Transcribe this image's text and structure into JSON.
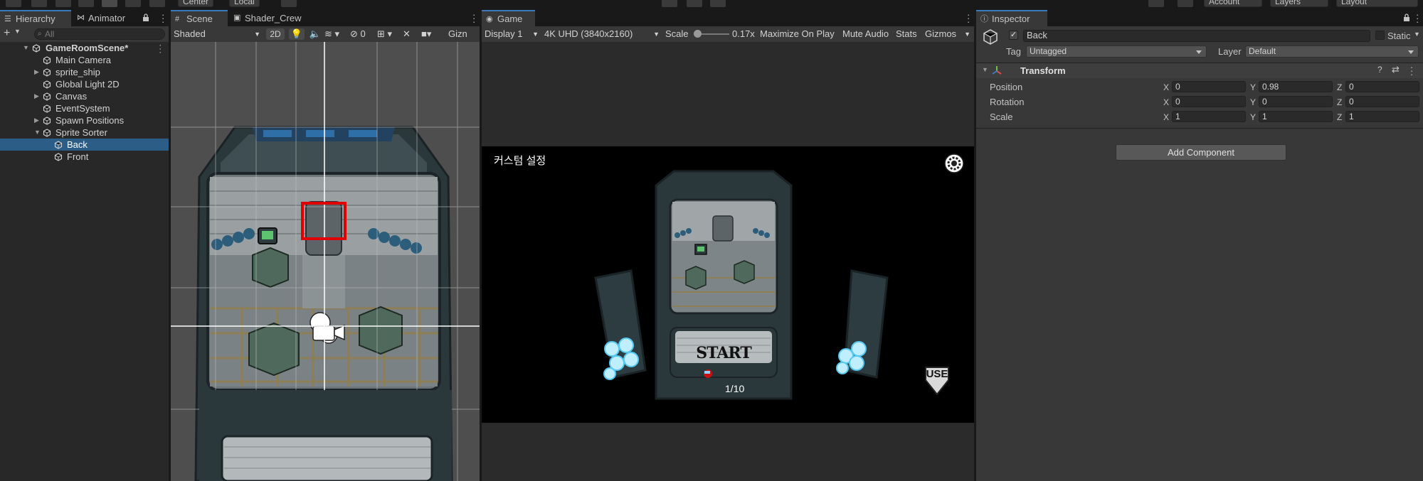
{
  "toolbar": {
    "pivot_center": "Center",
    "pivot_local": "Local",
    "account": "Account",
    "layers": "Layers",
    "layout": "Layout"
  },
  "hierarchy": {
    "tab_hierarchy": "Hierarchy",
    "tab_animator": "Animator",
    "search_placeholder": "All",
    "scene_name": "GameRoomScene*",
    "items": [
      {
        "label": "Main Camera",
        "depth": 1,
        "expand": ""
      },
      {
        "label": "sprite_ship",
        "depth": 1,
        "expand": "▶"
      },
      {
        "label": "Global Light 2D",
        "depth": 1,
        "expand": ""
      },
      {
        "label": "Canvas",
        "depth": 1,
        "expand": "▶"
      },
      {
        "label": "EventSystem",
        "depth": 1,
        "expand": ""
      },
      {
        "label": "Spawn Positions",
        "depth": 1,
        "expand": "▶"
      },
      {
        "label": "Sprite Sorter",
        "depth": 1,
        "expand": "▼"
      },
      {
        "label": "Back",
        "depth": 2,
        "expand": "",
        "selected": true
      },
      {
        "label": "Front",
        "depth": 2,
        "expand": ""
      }
    ]
  },
  "scene": {
    "tab_scene": "Scene",
    "tab_shader": "Shader_Crew",
    "draw_mode": "Shaded",
    "mode_2d": "2D",
    "hidden_count": "0",
    "gizmos_truncated": "Gizn"
  },
  "game": {
    "tab_game": "Game",
    "display": "Display 1",
    "resolution": "4K UHD (3840x2160)",
    "scale_label": "Scale",
    "scale_value": "0.17x",
    "maximize": "Maximize On Play",
    "mute": "Mute Audio",
    "stats": "Stats",
    "gizmos": "Gizmos",
    "custom_settings": "커스텀 설정",
    "start_label": "START",
    "player_count": "1/10",
    "use_label": "USE"
  },
  "inspector": {
    "tab": "Inspector",
    "object_name": "Back",
    "static_label": "Static",
    "tag_label": "Tag",
    "tag_value": "Untagged",
    "layer_label": "Layer",
    "layer_value": "Default",
    "component_name": "Transform",
    "position_label": "Position",
    "rotation_label": "Rotation",
    "scale_label": "Scale",
    "position": {
      "x": "0",
      "y": "0.98",
      "z": "0"
    },
    "rotation": {
      "x": "0",
      "y": "0",
      "z": "0"
    },
    "scale": {
      "x": "1",
      "y": "1",
      "z": "1"
    },
    "axis_x": "X",
    "axis_y": "Y",
    "axis_z": "Z",
    "add_component": "Add Component"
  },
  "colors": {
    "selection": "#2c5d87",
    "accent_tab": "#3a79bb",
    "highlight_red": "#e00000"
  }
}
